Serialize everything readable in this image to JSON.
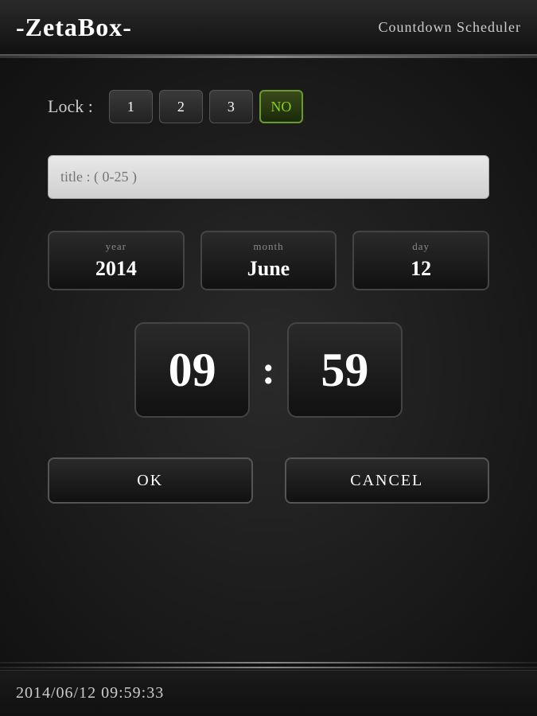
{
  "header": {
    "title": "-ZetaBox-",
    "subtitle": "Countdown Scheduler"
  },
  "lock": {
    "label": "Lock :",
    "buttons": [
      {
        "value": "1",
        "active": false
      },
      {
        "value": "2",
        "active": false
      },
      {
        "value": "3",
        "active": false
      },
      {
        "value": "NO",
        "active": true
      }
    ]
  },
  "title_input": {
    "placeholder": "title : ( 0-25 )",
    "value": ""
  },
  "date": {
    "year": {
      "label": "year",
      "value": "2014"
    },
    "month": {
      "label": "month",
      "value": "June"
    },
    "day": {
      "label": "day",
      "value": "12"
    }
  },
  "time": {
    "hours": "09",
    "separator": ":",
    "minutes": "59"
  },
  "buttons": {
    "ok": "OK",
    "cancel": "CANCEL"
  },
  "status_bar": {
    "text": "2014/06/12  09:59:33"
  }
}
